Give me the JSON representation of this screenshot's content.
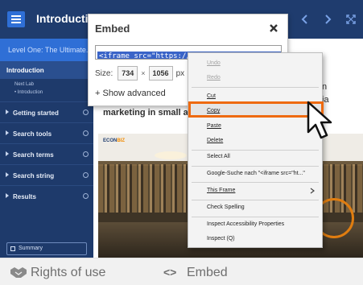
{
  "player": {
    "course_title": "Introduction",
    "sidebar": {
      "level_header": "Level One: The Ultimate...",
      "introduction_section": "Introduction",
      "sub_items": [
        "Next Lab",
        "• Introduction"
      ],
      "sections": [
        "Getting started",
        "Search tools",
        "Search terms",
        "Search string",
        "Results"
      ],
      "summary_label": "Summary"
    },
    "content": {
      "text_line1": "n",
      "text_line2": "ia",
      "text_line3": "marketing in small and",
      "video_logo_prefix": "ECON",
      "video_logo_accent": "BIZ"
    }
  },
  "embed_dialog": {
    "title": "Embed",
    "code": "<iframe src=\"https://researchskills.econbiz.de/en",
    "size_label": "Size:",
    "width": "734",
    "times": "×",
    "height": "1056",
    "unit": "px",
    "show_advanced": "+ Show advanced"
  },
  "context_menu": {
    "items": {
      "undo": "Undo",
      "redo": "Redo",
      "cut": "Cut",
      "copy": "Copy",
      "paste": "Paste",
      "delete": "Delete",
      "select_all": "Select All",
      "google_search": "Google-Suche nach \"<iframe src=\"ht...\"",
      "this_frame": "This Frame",
      "check_spelling": "Check Spelling",
      "inspect_accessibility": "Inspect Accessibility Properties",
      "inspect": "Inspect (Q)"
    },
    "highlight_color": "#ee6a10"
  },
  "bottom_bar": {
    "rights_of_use": "Rights of use",
    "embed_icon": "<>",
    "embed": "Embed"
  },
  "colors": {
    "topbar": "#1f3c6e",
    "accent_blue": "#2f6fd6",
    "sidebar": "#1e3a6b",
    "selection": "#3a64c8"
  }
}
